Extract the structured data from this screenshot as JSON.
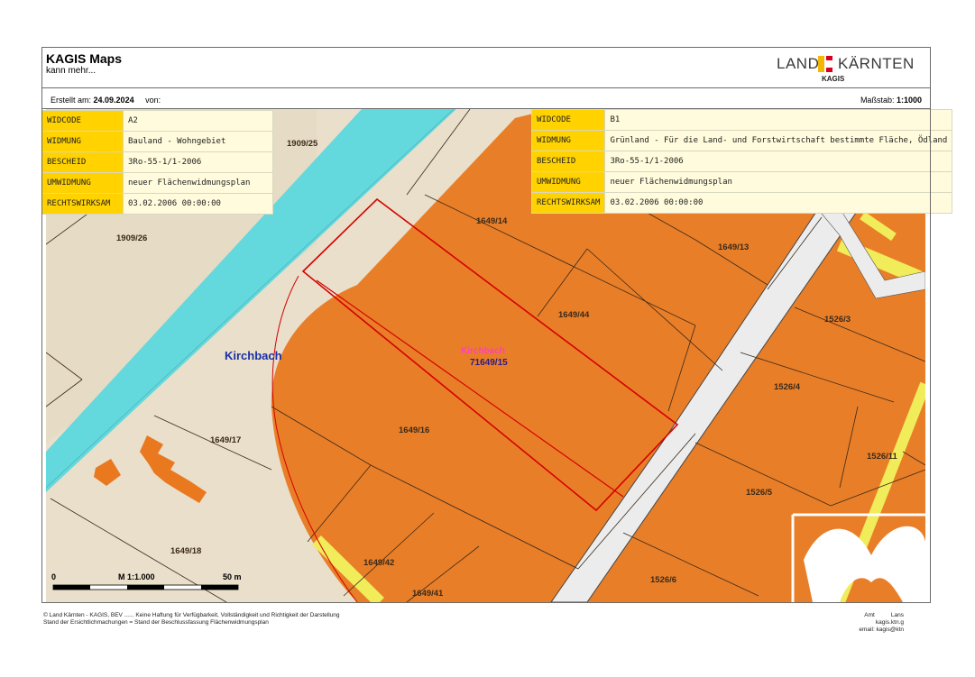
{
  "header": {
    "title": "KAGIS Maps",
    "subtitle": "kann mehr...",
    "logo_land": "LAND",
    "logo_kaernten": "KÄRNTEN",
    "logo_kagis": "KAGIS",
    "logo_colors": {
      "yellow": "#f2b705",
      "red": "#d6001c"
    }
  },
  "meta": {
    "created_label": "Erstellt am:",
    "created_value": "24.09.2024",
    "von_label": "von:",
    "scale_label": "Maßstab:",
    "scale_value": "1:1000"
  },
  "info_left": [
    {
      "key": "WIDCODE",
      "value": "A2"
    },
    {
      "key": "WIDMUNG",
      "value": "Bauland - Wohngebiet"
    },
    {
      "key": "BESCHEID",
      "value": "3Ro-55-1/1-2006"
    },
    {
      "key": "UMWIDMUNG",
      "value": "neuer Flächenwidmungsplan"
    },
    {
      "key": "RECHTSWIRKSAM",
      "value": "03.02.2006 00:00:00"
    }
  ],
  "info_right": [
    {
      "key": "WIDCODE",
      "value": "B1"
    },
    {
      "key": "WIDMUNG",
      "value": "Grünland - Für die Land- und Forstwirtschaft bestimmte Fläche, Ödland"
    },
    {
      "key": "BESCHEID",
      "value": "3Ro-55-1/1-2006"
    },
    {
      "key": "UMWIDMUNG",
      "value": "neuer Flächenwidmungsplan"
    },
    {
      "key": "RECHTSWIRKSAM",
      "value": "03.02.2006 00:00:00"
    }
  ],
  "map": {
    "colors": {
      "water": "#63d8dd",
      "zoning": "#e9781f",
      "road": "#f1ec5a",
      "base": "#e9dfca",
      "highlight": "#d40000"
    },
    "river_label": "Kirchbach",
    "selected_label_name": "Kirchbach",
    "selected_label_parcel": "71649/15",
    "parcels": {
      "p1909_25": "1909/25",
      "p1909_26": "1909/26",
      "p1649_14": "1649/14",
      "p1649_13": "1649/13",
      "p1649_44": "1649/44",
      "p1526_3": "1526/3",
      "p1526_4": "1526/4",
      "p1649_16": "1649/16",
      "p1649_17": "1649/17",
      "p1526_11": "1526/11",
      "p1526_5": "1526/5",
      "p1649_18": "1649/18",
      "p1649_42": "1649/42",
      "p1649_41": "1649/41",
      "p1526_6": "1526/6",
      "p152x": "15"
    },
    "scalebar": {
      "zero": "0",
      "ratio": "M 1:1.000",
      "distance": "50 m"
    }
  },
  "footer": {
    "line1": "© Land Kärnten - KAGIS, BEV ...... Keine Haftung für Verfügbarkeit, Vollständigkeit und Richtigkeit der Darstellung",
    "line2": "Stand der Ersichtlichmachungen = Stand der Beschlussfassung Flächenwidmungsplan",
    "right1": "Amt",
    "right1b": "Lans",
    "right2": "kagis.ktn.g",
    "right3": "email: kagis@ktn"
  }
}
